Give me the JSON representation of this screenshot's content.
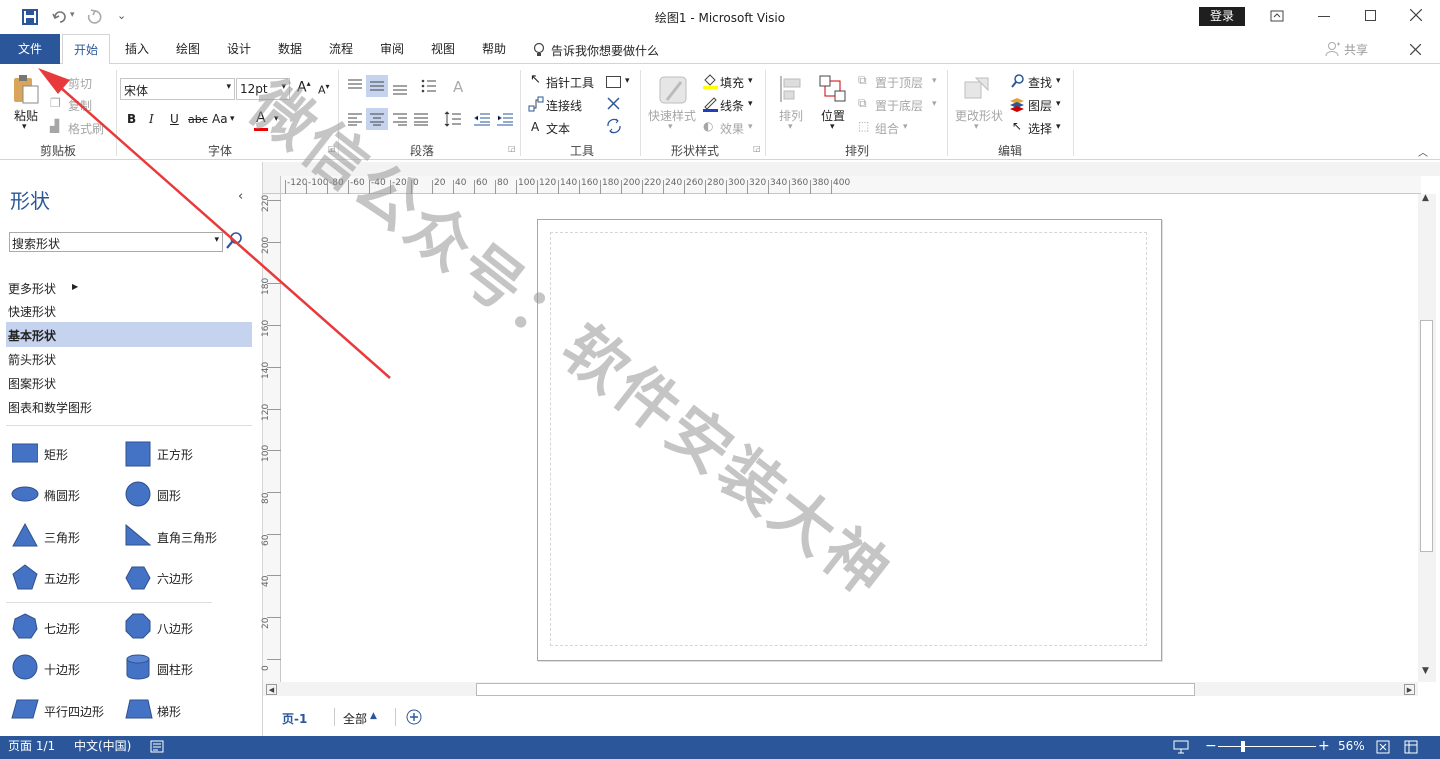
{
  "window": {
    "title": "绘图1  -  Microsoft Visio",
    "signin": "登录"
  },
  "tabs": [
    {
      "label": "文件"
    },
    {
      "label": "开始"
    },
    {
      "label": "插入"
    },
    {
      "label": "绘图"
    },
    {
      "label": "设计"
    },
    {
      "label": "数据"
    },
    {
      "label": "流程"
    },
    {
      "label": "审阅"
    },
    {
      "label": "视图"
    },
    {
      "label": "帮助"
    }
  ],
  "tell_me": "告诉我你想要做什么",
  "share": "共享",
  "ribbon": {
    "clipboard": {
      "paste": "粘贴",
      "cut": "剪切",
      "copy": "复制",
      "format_painter": "格式刷",
      "label": "剪贴板"
    },
    "font": {
      "family": "宋体",
      "size": "12pt",
      "bold": "B",
      "italic": "I",
      "underline": "U",
      "strike": "abc",
      "case": "Aa",
      "color": "A",
      "label": "字体"
    },
    "paragraph": {
      "label": "段落"
    },
    "tools": {
      "pointer": "指针工具",
      "connector": "连接线",
      "text_prefix": "A",
      "text": "文本",
      "label": "工具"
    },
    "shape_styles": {
      "quick": "快速样式",
      "fill": "填充",
      "line": "线条",
      "effects": "效果",
      "label": "形状样式"
    },
    "arrange": {
      "align": "排列",
      "position": "位置",
      "bring_front": "置于顶层",
      "send_back": "置于底层",
      "group": "组合",
      "label": "排列"
    },
    "editing": {
      "change_shape": "更改形状",
      "find": "查找",
      "layers": "图层",
      "select": "选择",
      "label": "编辑"
    }
  },
  "shapes_pane": {
    "title": "形状",
    "search_placeholder": "搜索形状",
    "nav": [
      {
        "label": "更多形状"
      },
      {
        "label": "快速形状"
      },
      {
        "label": "基本形状"
      },
      {
        "label": "箭头形状"
      },
      {
        "label": "图案形状"
      },
      {
        "label": "图表和数学图形"
      }
    ],
    "stencil": [
      {
        "label": "矩形"
      },
      {
        "label": "正方形"
      },
      {
        "label": "椭圆形"
      },
      {
        "label": "圆形"
      },
      {
        "label": "三角形"
      },
      {
        "label": "直角三角形"
      },
      {
        "label": "五边形"
      },
      {
        "label": "六边形"
      },
      {
        "label": "七边形"
      },
      {
        "label": "八边形"
      },
      {
        "label": "十边形"
      },
      {
        "label": "圆柱形"
      },
      {
        "label": "平行四边形"
      },
      {
        "label": "梯形"
      }
    ]
  },
  "ruler_h": [
    "-120",
    "-100",
    "-80",
    "-60",
    "-40",
    "-20",
    "0",
    "20",
    "40",
    "60",
    "80",
    "100",
    "120",
    "140",
    "160",
    "180",
    "200",
    "220",
    "240",
    "260",
    "280",
    "300",
    "320",
    "340",
    "360",
    "380",
    "400"
  ],
  "ruler_v": [
    "220",
    "200",
    "180",
    "160",
    "140",
    "120",
    "100",
    "80",
    "60",
    "40",
    "20",
    "0"
  ],
  "page_tabs": {
    "page": "页-1",
    "all": "全部"
  },
  "watermark": "微信公众号：软件安装大神",
  "status": {
    "page": "页面 1/1",
    "lang": "中文(中国)",
    "zoom": "56%"
  },
  "colors": {
    "accent": "#2b579a",
    "shape_fill": "#4472c4",
    "selected_nav": "#c5d3ee",
    "arrow": "#e8393b"
  }
}
